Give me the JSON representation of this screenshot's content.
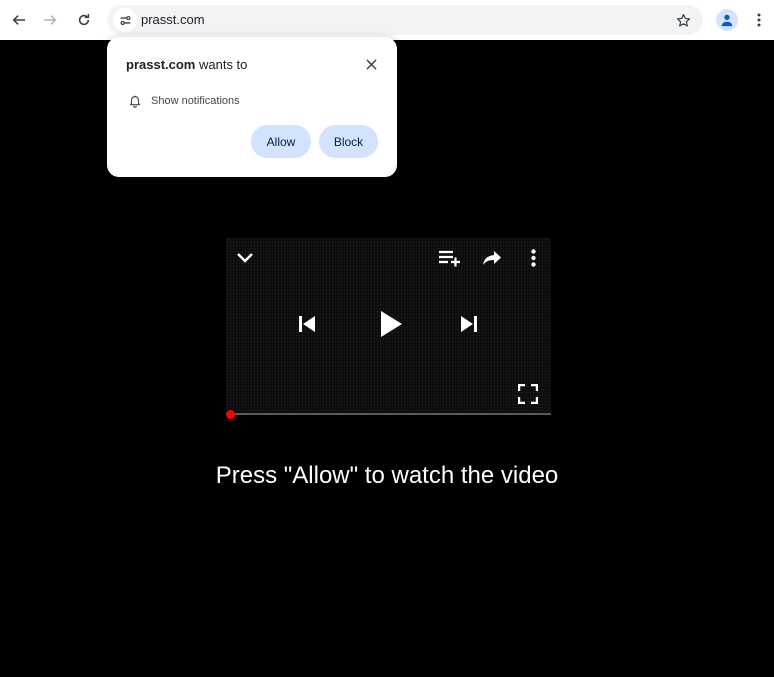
{
  "browser": {
    "url": "prasst.com",
    "icons": {
      "back": "arrow-left-icon",
      "forward": "arrow-right-icon",
      "reload": "reload-icon",
      "site_info": "tune-icon",
      "bookmark": "star-icon",
      "profile": "person-icon",
      "menu": "kebab-menu-icon"
    }
  },
  "permission_popup": {
    "site": "prasst.com",
    "wants_to": " wants to",
    "permission": "Show notifications",
    "allow_label": "Allow",
    "block_label": "Block",
    "icons": {
      "close": "close-icon",
      "permission": "bell-icon"
    }
  },
  "player": {
    "icons": {
      "collapse": "chevron-down-icon",
      "queue": "playlist-add-icon",
      "share": "share-icon",
      "more": "more-vert-icon",
      "previous": "skip-previous-icon",
      "play": "play-icon",
      "next": "skip-next-icon",
      "fullscreen": "fullscreen-icon"
    },
    "progress": 0,
    "progress_color": "#ff0000"
  },
  "page": {
    "caption": "Press \"Allow\" to watch the video"
  },
  "colors": {
    "page_background": "#000000",
    "button_background": "#d3e3fd",
    "button_text": "#041e49"
  }
}
